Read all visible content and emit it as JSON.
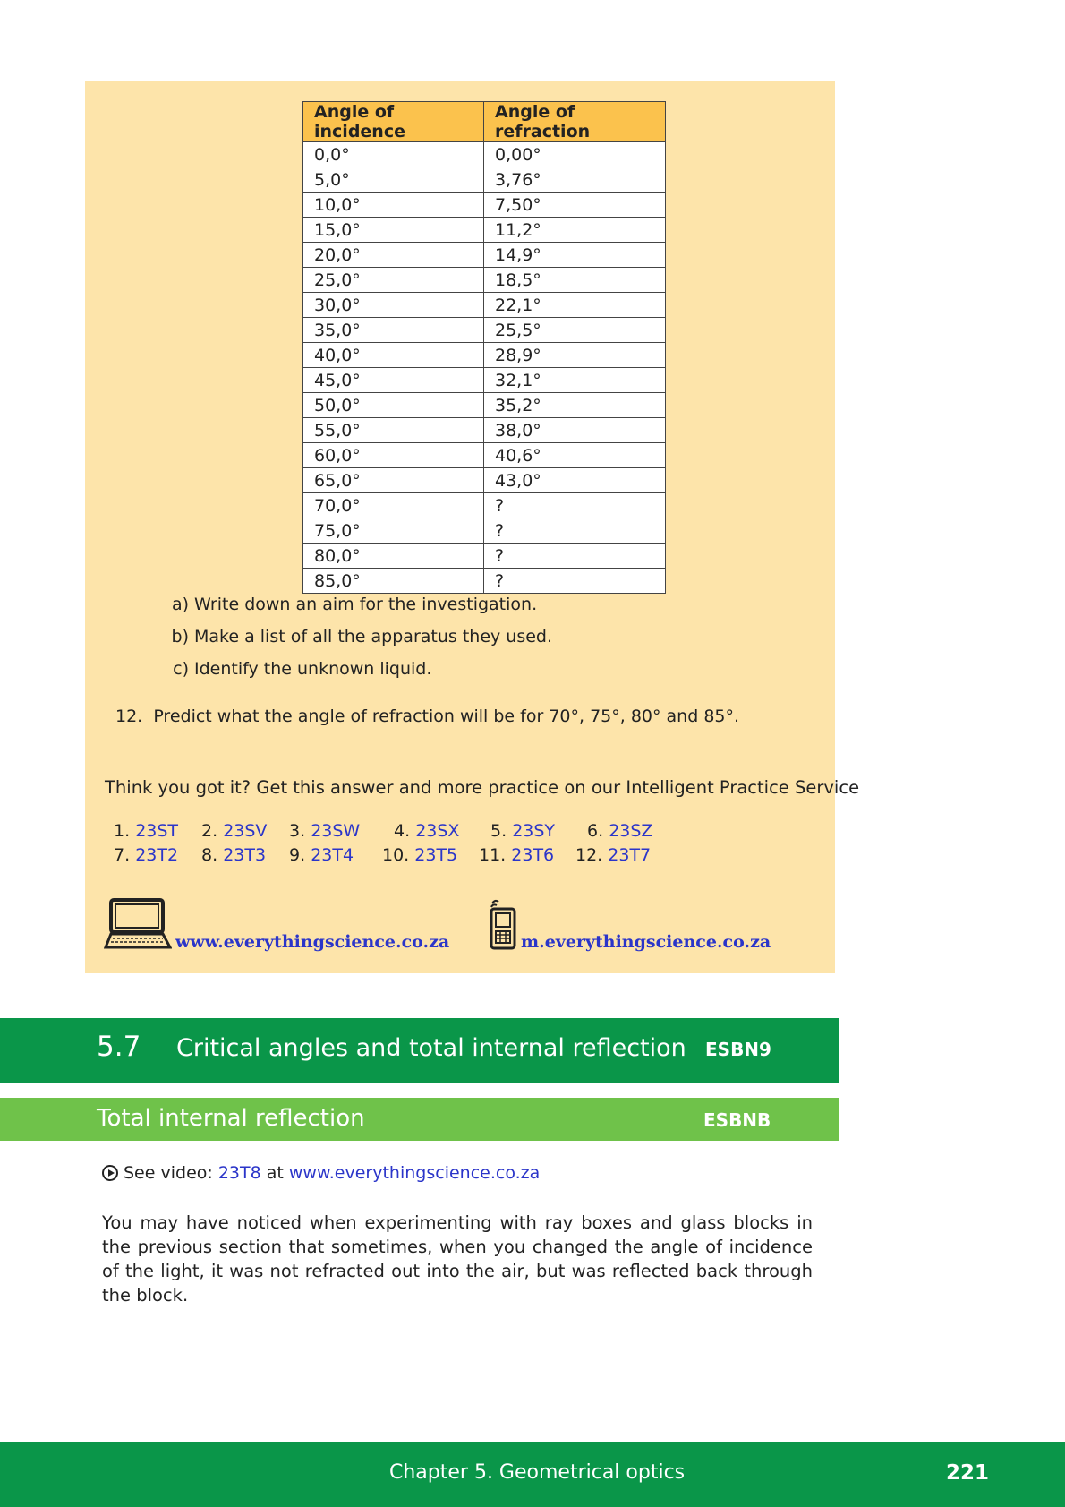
{
  "table": {
    "headers": [
      "Angle of incidence",
      "Angle of refraction"
    ],
    "rows": [
      [
        "0,0°",
        "0,00°"
      ],
      [
        "5,0°",
        "3,76°"
      ],
      [
        "10,0°",
        "7,50°"
      ],
      [
        "15,0°",
        "11,2°"
      ],
      [
        "20,0°",
        "14,9°"
      ],
      [
        "25,0°",
        "18,5°"
      ],
      [
        "30,0°",
        "22,1°"
      ],
      [
        "35,0°",
        "25,5°"
      ],
      [
        "40,0°",
        "28,9°"
      ],
      [
        "45,0°",
        "32,1°"
      ],
      [
        "50,0°",
        "35,2°"
      ],
      [
        "55,0°",
        "38,0°"
      ],
      [
        "60,0°",
        "40,6°"
      ],
      [
        "65,0°",
        "43,0°"
      ],
      [
        "70,0°",
        "?"
      ],
      [
        "75,0°",
        "?"
      ],
      [
        "80,0°",
        "?"
      ],
      [
        "85,0°",
        "?"
      ]
    ]
  },
  "subquestions": [
    {
      "label": "a)",
      "text": "Write down an aim for the investigation."
    },
    {
      "label": "b)",
      "text": "Make a list of all the apparatus they used."
    },
    {
      "label": "c)",
      "text": "Identify the unknown liquid."
    }
  ],
  "question12": {
    "number": "12.",
    "text": "Predict what the angle of refraction will be for 70°, 75°, 80° and 85°."
  },
  "practice_text": "Think you got it? Get this answer and more practice on our Intelligent Practice Service",
  "codes": [
    {
      "num": "1.",
      "code": "23ST"
    },
    {
      "num": "2.",
      "code": "23SV"
    },
    {
      "num": "3.",
      "code": "23SW"
    },
    {
      "num": "4.",
      "code": "23SX"
    },
    {
      "num": "5.",
      "code": "23SY"
    },
    {
      "num": "6.",
      "code": "23SZ"
    },
    {
      "num": "7.",
      "code": "23T2"
    },
    {
      "num": "8.",
      "code": "23T3"
    },
    {
      "num": "9.",
      "code": "23T4"
    },
    {
      "num": "10.",
      "code": "23T5"
    },
    {
      "num": "11.",
      "code": "23T6"
    },
    {
      "num": "12.",
      "code": "23T7"
    }
  ],
  "links": {
    "desktop": "www.everythingscience.co.za",
    "mobile": "m.everythingscience.co.za"
  },
  "section": {
    "number": "5.7",
    "title": "Critical angles and total internal reflection",
    "code": "ESBN9"
  },
  "subsection": {
    "title": "Total internal reflection",
    "code": "ESBNB"
  },
  "video": {
    "prefix": "See video:",
    "code": "23T8",
    "middle": "at",
    "url": "www.everythingscience.co.za"
  },
  "paragraph": "You may have noticed when experimenting with ray boxes and glass blocks in the previous section that sometimes, when you changed the angle of incidence of the light, it was not refracted out into the air, but was reflected back through the block.",
  "footer": {
    "chapter": "Chapter 5.   Geometrical optics",
    "page": "221"
  },
  "colors": {
    "box_bg": "#fde4aa",
    "table_header": "#fbc24d",
    "section_green": "#0a9649",
    "subsection_green": "#6fc24a",
    "link_blue": "#2b35c9"
  }
}
